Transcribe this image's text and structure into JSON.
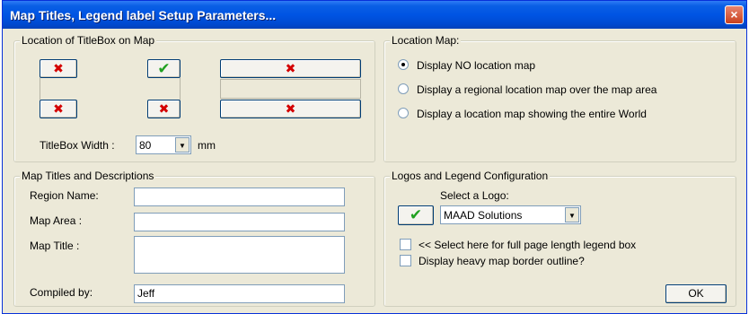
{
  "window": {
    "title": "Map Titles, Legend label Setup Parameters...",
    "close": "×"
  },
  "titlebox": {
    "legend": "Location of TitleBox on Map",
    "icons": {
      "x": "✖",
      "check": "✔"
    },
    "width_label": "TitleBox Width :",
    "width_value": "80",
    "width_unit": "mm"
  },
  "location_map": {
    "legend": "Location Map:",
    "options": [
      {
        "label": "Display NO location map",
        "checked": true
      },
      {
        "label": "Display a regional location map over the map area",
        "checked": false
      },
      {
        "label": "Display a location map showing the entire World",
        "checked": false
      }
    ]
  },
  "titles": {
    "legend": "Map Titles and Descriptions",
    "region_label": "Region Name:",
    "region_value": "",
    "area_label": "Map Area :",
    "area_value": "",
    "title_label": "Map Title :",
    "title_value": "",
    "compiled_label": "Compiled by:",
    "compiled_value": "Jeff"
  },
  "logos": {
    "legend": "Logos and Legend Configuration",
    "select_label": "Select a Logo:",
    "logo_value": "MAAD Solutions",
    "full_page_label": "<< Select here for full page length legend box",
    "border_label": "Display heavy map border outline?"
  },
  "ok_label": "OK"
}
